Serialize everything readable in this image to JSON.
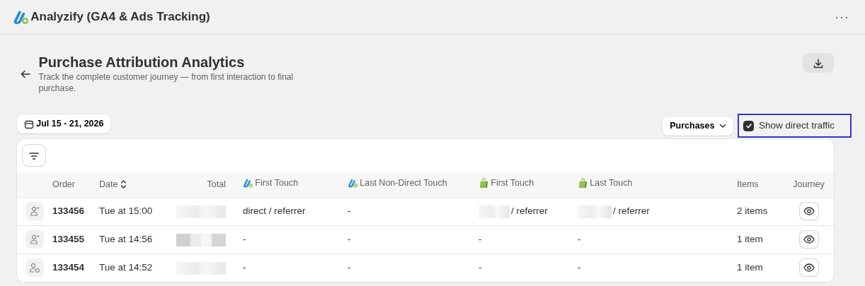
{
  "app": {
    "title": "Analyzify (GA4 & Ads Tracking)",
    "menu_glyph": "···"
  },
  "page": {
    "title": "Purchase Attribution Analytics",
    "subtitle": "Track the complete customer journey — from first interaction to final purchase."
  },
  "date_range": "Jul 15 - 21, 2026",
  "metric_select": "Purchases",
  "direct_traffic": {
    "label": "Show direct traffic",
    "checked": true,
    "highlighted": true
  },
  "table": {
    "columns": [
      {
        "kind": "blank"
      },
      {
        "label": "Order",
        "kind": "plain"
      },
      {
        "label": "Date",
        "kind": "sortable"
      },
      {
        "label": "Total",
        "kind": "plain"
      },
      {
        "label": "First Touch",
        "kind": "analyzify"
      },
      {
        "label": "Last Non-Direct Touch",
        "kind": "analyzify"
      },
      {
        "label": "First Touch",
        "kind": "shopify"
      },
      {
        "label": "Last Touch",
        "kind": "shopify"
      },
      {
        "label": "Items",
        "kind": "plain"
      },
      {
        "label": "Journey",
        "kind": "plain"
      }
    ],
    "rows": [
      {
        "kind": "new",
        "order": "133456",
        "date": "Tue at 15:00",
        "total_redacted": true,
        "ga_first": "direct / referrer",
        "ga_last": "-",
        "shop_first": {
          "text": "/ referrer",
          "redacted_prefix": true
        },
        "shop_last": {
          "text": "/ referrer",
          "redacted_prefix": true
        },
        "items": "2 items"
      },
      {
        "kind": "new",
        "order": "133455",
        "date": "Tue at 14:56",
        "total_redacted": true,
        "ga_first": "-",
        "ga_last": "-",
        "shop_first": {
          "text": "-",
          "redacted_prefix": false
        },
        "shop_last": {
          "text": "-",
          "redacted_prefix": false
        },
        "items": "1 item"
      },
      {
        "kind": "returning",
        "order": "133454",
        "date": "Tue at 14:52",
        "total_redacted": true,
        "ga_first": "-",
        "ga_last": "-",
        "shop_first": {
          "text": "-",
          "redacted_prefix": false
        },
        "shop_last": {
          "text": "-",
          "redacted_prefix": false
        },
        "items": "1 item"
      }
    ]
  }
}
